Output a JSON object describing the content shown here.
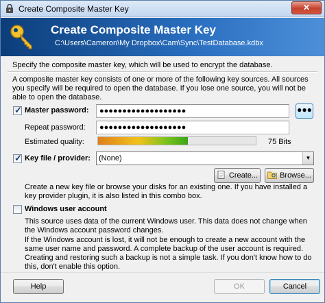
{
  "window": {
    "title": "Create Composite Master Key",
    "close_label": "✕"
  },
  "header": {
    "title": "Create Composite Master Key",
    "path": "C:\\Users\\Cameron\\My Dropbox\\Cam\\Sync\\TestDatabase.kdbx"
  },
  "intro": {
    "line1": "Specify the composite master key, which will be used to encrypt the database.",
    "line2": "A composite master key consists of one or more of the following key sources. All sources you specify will be required to open the database.  If you lose one source, you will not be able to open the database."
  },
  "master_password": {
    "checked": true,
    "label": "Master password:",
    "value": "●●●●●●●●●●●●●●●●●●●",
    "toggle_label": "●●●",
    "repeat_label": "Repeat password:",
    "repeat_value": "●●●●●●●●●●●●●●●●●●●",
    "quality_label": "Estimated quality:",
    "quality_value": "75 Bits",
    "quality_fraction": 0.57
  },
  "key_file": {
    "checked": true,
    "label": "Key file / provider:",
    "selected": "(None)",
    "create_label": "Create...",
    "browse_label": "Browse...",
    "hint": "Create a new key file or browse your disks for an existing one. If you have installed a key provider plugin, it is also listed in this combo box."
  },
  "windows_account": {
    "checked": false,
    "label": "Windows user account",
    "desc1": "This source uses data of the current Windows user. This data does not change when the Windows account password changes.",
    "desc2": "If the Windows account is lost, it will not be enough to create a new account with the same user name and password. A complete backup of the user account is required. Creating and restoring such a backup is not a simple task. If you don't know how to do this, don't enable this option."
  },
  "footer": {
    "help_label": "Help",
    "ok_label": "OK",
    "cancel_label": "Cancel"
  },
  "colors": {
    "banner_dark": "#0c3d7a",
    "banner_light": "#4d8fd8",
    "close_red": "#c4412d"
  },
  "icons": [
    "keepass-app-icon",
    "key-icon",
    "close-icon",
    "create-file-icon",
    "browse-folder-icon",
    "dropdown-arrow-icon",
    "checkmark-icon"
  ]
}
